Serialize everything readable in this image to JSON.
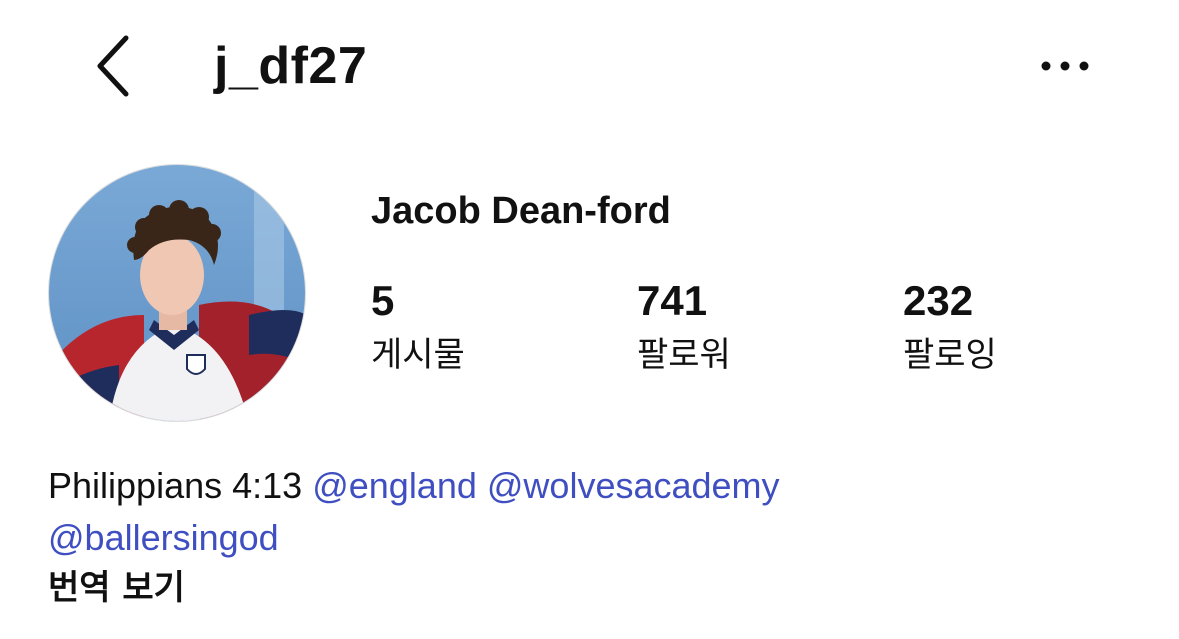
{
  "header": {
    "username": "j_df27",
    "back_icon": "chevron-left-icon",
    "more_icon": "more-horizontal-icon"
  },
  "profile": {
    "full_name": "Jacob Dean-ford",
    "avatar": "profile-photo",
    "stats": {
      "posts": {
        "count": "5",
        "label": "게시물"
      },
      "followers": {
        "count": "741",
        "label": "팔로워"
      },
      "following": {
        "count": "232",
        "label": "팔로잉"
      }
    },
    "bio": {
      "text": "Philippians 4:13",
      "mentions": [
        "@england",
        "@wolvesacademy",
        "@ballersingod"
      ]
    },
    "translate_label": "번역 보기"
  },
  "colors": {
    "mention": "#3f4fc2",
    "text": "#111111"
  }
}
